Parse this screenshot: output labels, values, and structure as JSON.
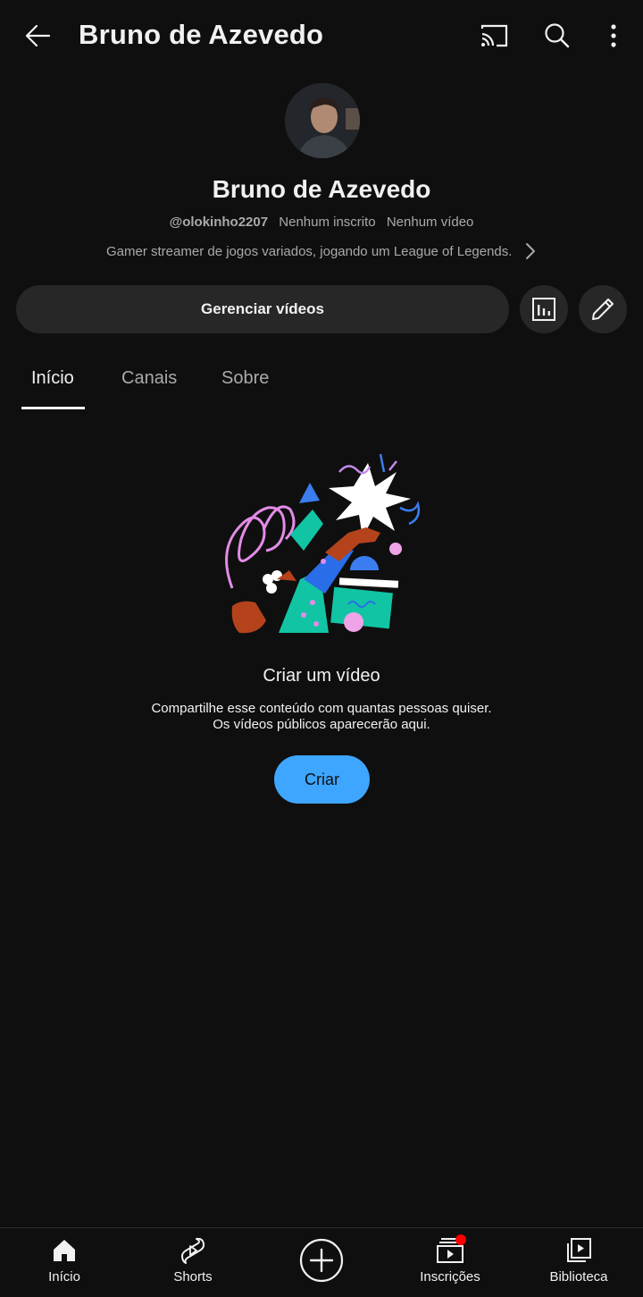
{
  "header": {
    "title": "Bruno de Azevedo",
    "back_icon": "arrow-left-icon",
    "cast_icon": "cast-icon",
    "search_icon": "search-icon",
    "more_icon": "more-vertical-icon"
  },
  "channel": {
    "name": "Bruno de Azevedo",
    "handle": "@olokinho2207",
    "subscribers": "Nenhum inscrito",
    "videos": "Nenhum vídeo",
    "description": "Gamer streamer de jogos variados, jogando um League of Legends."
  },
  "actions": {
    "manage_label": "Gerenciar vídeos",
    "analytics_icon": "analytics-icon",
    "edit_icon": "pencil-icon"
  },
  "tabs": [
    {
      "label": "Início",
      "active": true
    },
    {
      "label": "Canais",
      "active": false
    },
    {
      "label": "Sobre",
      "active": false
    }
  ],
  "empty_state": {
    "title": "Criar um vídeo",
    "line1": "Compartilhe esse conteúdo com quantas pessoas quiser.",
    "line2": "Os vídeos públicos aparecerão aqui.",
    "button_label": "Criar"
  },
  "bottom_nav": [
    {
      "label": "Início",
      "icon": "home-icon"
    },
    {
      "label": "Shorts",
      "icon": "shorts-icon"
    },
    {
      "label": "",
      "icon": "create-plus-icon"
    },
    {
      "label": "Inscrições",
      "icon": "subscriptions-icon"
    },
    {
      "label": "Biblioteca",
      "icon": "library-icon"
    }
  ],
  "colors": {
    "background": "#0f0f0f",
    "surface": "#272727",
    "accent": "#3ea6ff",
    "notification": "#ff0000"
  }
}
